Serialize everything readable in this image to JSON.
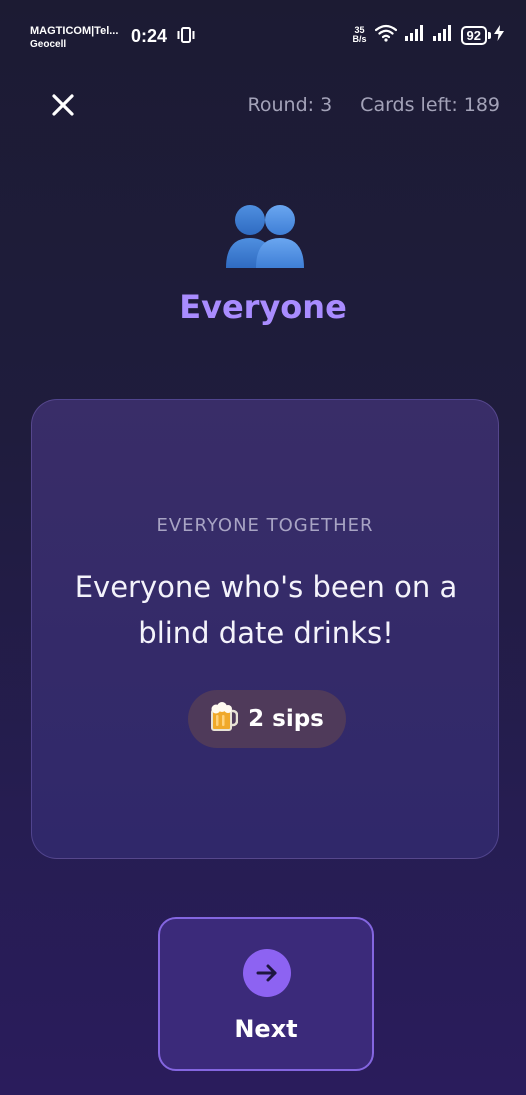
{
  "status_bar": {
    "carrier_line1": "MAGTICOM|Tel...",
    "carrier_line2": "Geocell",
    "time": "0:24",
    "netspeed_value": "35",
    "netspeed_unit": "B/s",
    "battery": "92"
  },
  "header": {
    "round_label": "Round:",
    "round_value": "3",
    "cards_left_label": "Cards left:",
    "cards_left_value": "189"
  },
  "player": {
    "title": "Everyone",
    "icon": "two-people-icon"
  },
  "card": {
    "category": "EVERYONE TOGETHER",
    "text": "Everyone who's been on a blind date drinks!",
    "sips_emoji": "🍺",
    "sips_label": "2 sips"
  },
  "next_button": {
    "label": "Next",
    "icon": "arrow-right-icon"
  },
  "colors": {
    "accent": "#a98cff",
    "button_bg": "#3b2a7a",
    "arrow_circle": "#8d63f2",
    "badge_bg": "#4f3a5a"
  }
}
